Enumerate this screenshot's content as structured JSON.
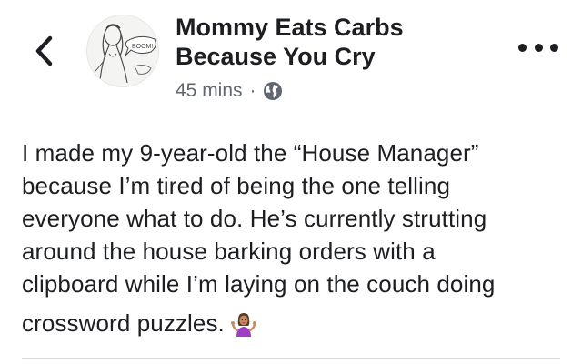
{
  "post": {
    "author": {
      "name_line1": "Mommy Eats Carbs",
      "name_line2": "Because You Cry",
      "avatar_icon": "sketch-avatar-icon",
      "avatar_caption": "BOOM!"
    },
    "meta": {
      "time": "45 mins",
      "separator": "·",
      "privacy_icon": "globe-icon"
    },
    "text_lines": [
      "I made my 9-year-old the “House Manager”",
      "because I’m tired of being the one telling",
      "everyone what to do. He’s currently strutting",
      "around the house barking orders with a",
      "clipboard while I’m laying on the couch doing",
      "crossword puzzles."
    ],
    "emoji": "person-shrugging-emoji"
  },
  "nav": {
    "back_icon": "chevron-left-icon",
    "more_icon": "more-horizontal-icon"
  },
  "colors": {
    "text": "#1c1e21",
    "secondary": "#606770",
    "divider": "#dadde1",
    "emoji_shirt": "#9c3fc5",
    "emoji_skin": "#c68a5e"
  }
}
